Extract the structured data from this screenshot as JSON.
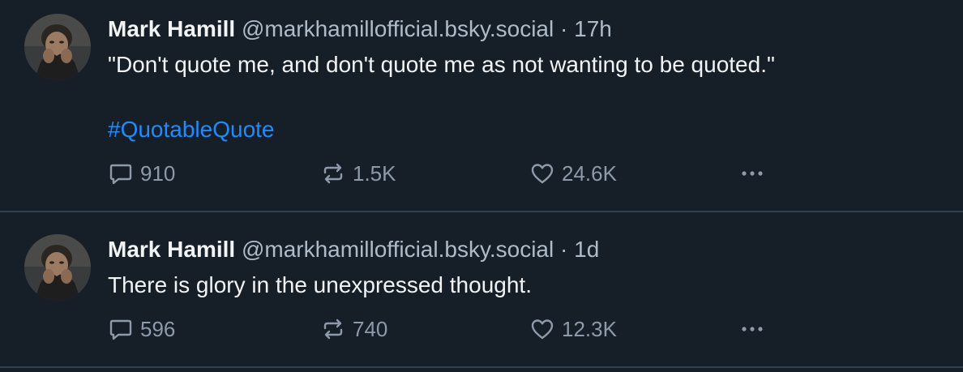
{
  "posts": [
    {
      "author": "Mark Hamill",
      "handle": "@markhamillofficial.bsky.social",
      "separator": "·",
      "time": "17h",
      "text": "\"Don't quote me, and don't quote me as not wanting to be quoted.\"",
      "hashtag": "#QuotableQuote",
      "replies": "910",
      "reposts": "1.5K",
      "likes": "24.6K"
    },
    {
      "author": "Mark Hamill",
      "handle": "@markhamillofficial.bsky.social",
      "separator": "·",
      "time": "1d",
      "text": "There is glory in the unexpressed thought.",
      "replies": "596",
      "reposts": "740",
      "likes": "12.3K"
    }
  ],
  "icons": {
    "reply": "speech-bubble-icon",
    "repost": "repost-arrows-icon",
    "like": "heart-icon",
    "more": "ellipsis-icon"
  },
  "colors": {
    "background": "#161e27",
    "text": "#f1f3f5",
    "muted": "#aebbc9",
    "hashtag": "#208bfe",
    "divider": "#2e4052"
  }
}
